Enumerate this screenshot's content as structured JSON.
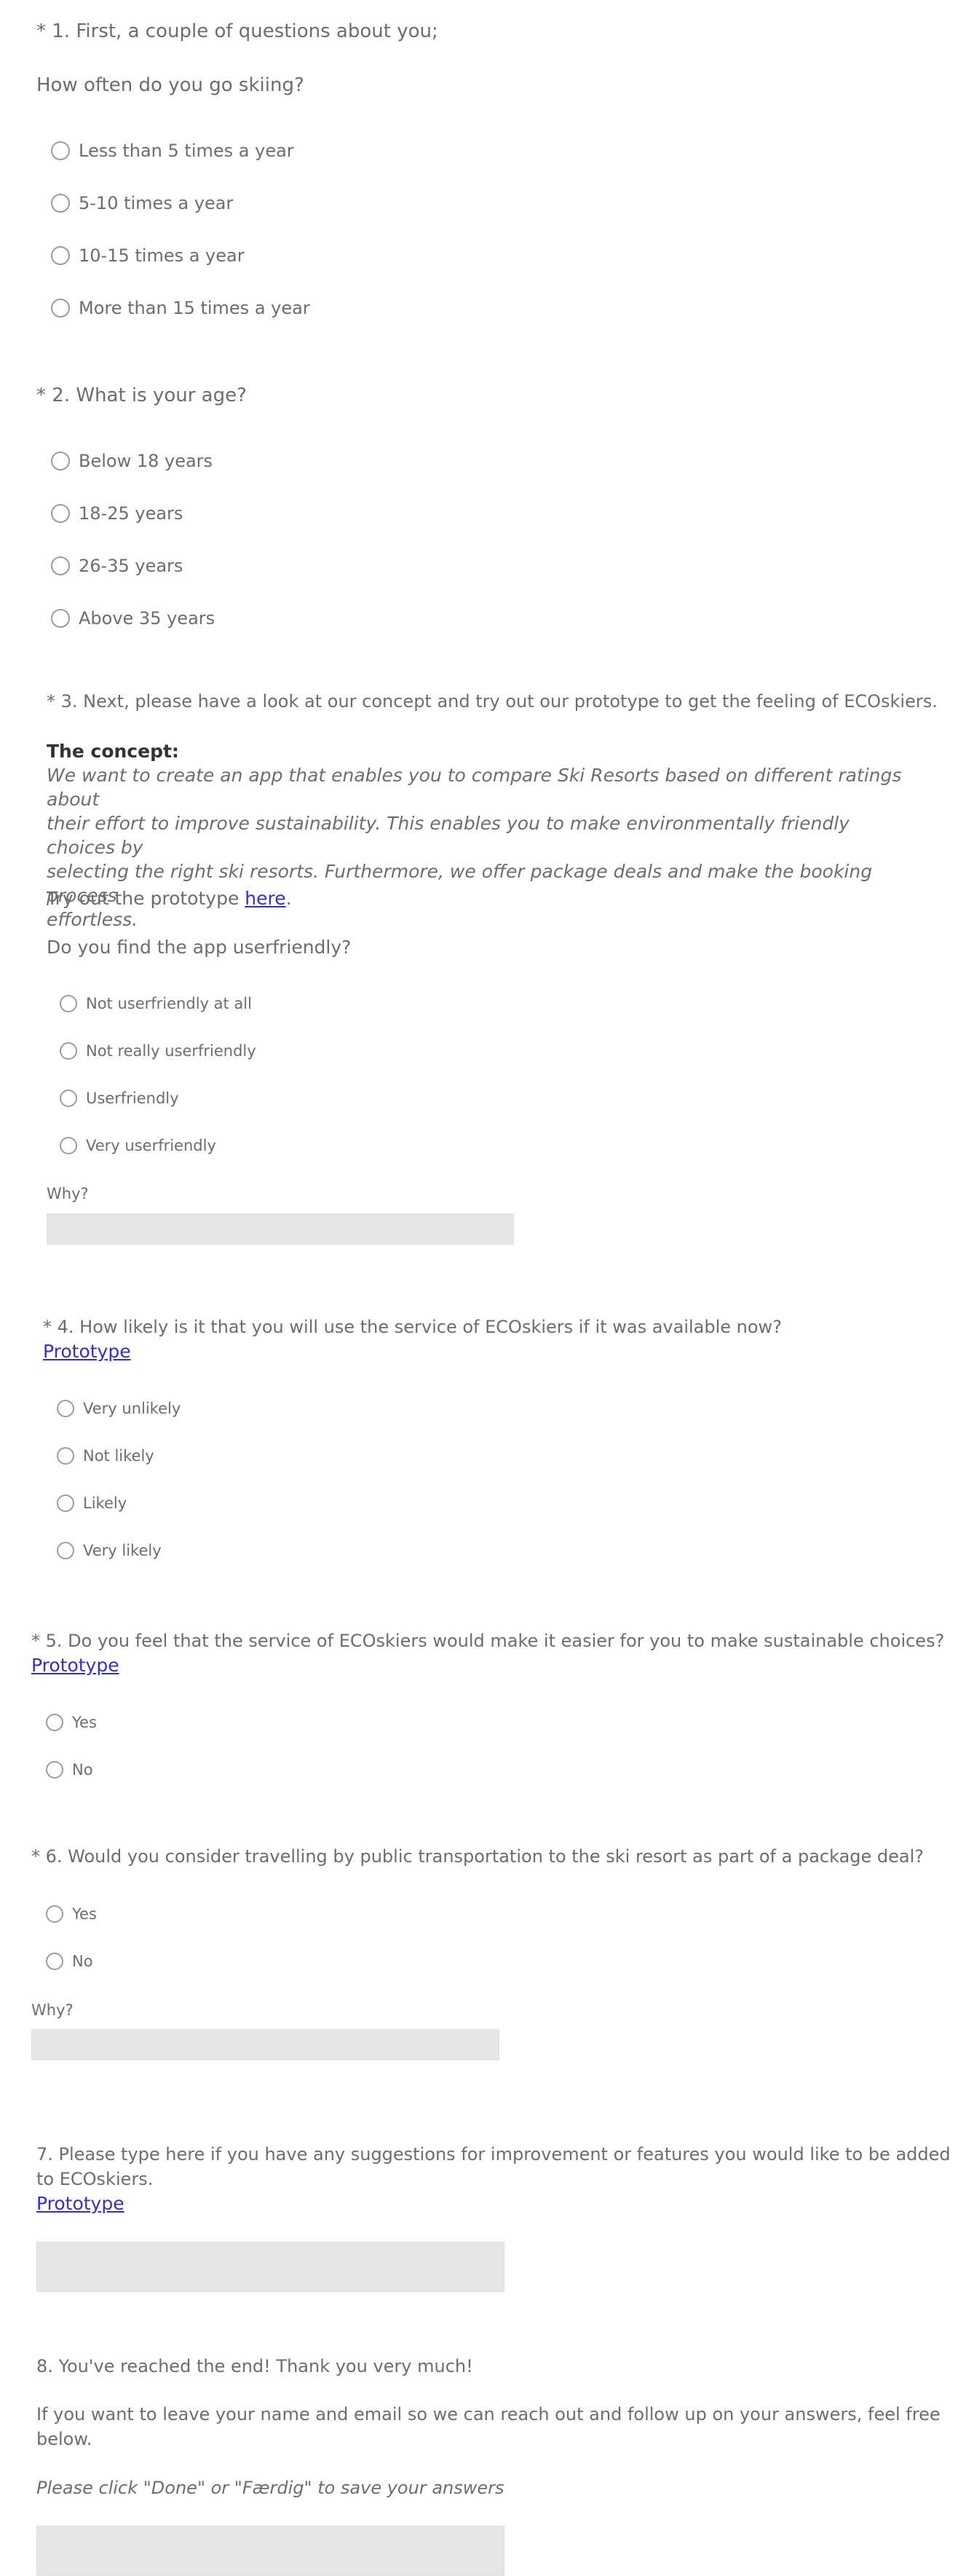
{
  "q1": {
    "title": "* 1. First, a couple of questions about you;",
    "subtitle": "How often do you go skiing?",
    "options": [
      "Less than 5 times a year",
      "5-10 times a year",
      "10-15 times a year",
      "More than 15 times a year"
    ]
  },
  "q2": {
    "title": "* 2. What is your age?",
    "options": [
      "Below 18 years",
      "18-25 years",
      "26-35 years",
      "Above 35 years"
    ]
  },
  "q3": {
    "title": "* 3. Next, please have a look at our concept and try out our prototype to get the feeling of ECOskiers.",
    "concept_heading": "The concept:",
    "concept_text": "We want to create an app that enables you to compare Ski Resorts based on different ratings about\ntheir effort to improve sustainability. This enables you to make environmentally friendly choices by\nselecting the right ski resorts. Furthermore, we offer package deals and make the booking process\neffortless.",
    "try_prefix": "Try out the prototype ",
    "try_link": "here",
    "try_suffix": ".",
    "question": "Do you find the app userfriendly?",
    "options": [
      "Not userfriendly at all",
      "Not really userfriendly",
      "Userfriendly",
      "Very userfriendly"
    ],
    "why_label": "Why?",
    "why_value": ""
  },
  "q4": {
    "title": "* 4. How likely is it that you will use the service of ECOskiers if it was available now?",
    "link": "Prototype",
    "options": [
      "Very unlikely",
      "Not likely",
      "Likely",
      "Very likely"
    ]
  },
  "q5": {
    "title": "* 5. Do you feel that the service of ECOskiers would make it easier for you to make sustainable choices?",
    "link": "Prototype",
    "options": [
      "Yes",
      "No"
    ]
  },
  "q6": {
    "title": "* 6. Would you consider travelling by public transportation to the ski resort as part of a package deal?",
    "options": [
      "Yes",
      "No"
    ],
    "why_label": "Why?",
    "why_value": ""
  },
  "q7": {
    "title_line1": "7. Please type here if you have any suggestions for improvement or features you would like to be added",
    "title_line2": "to ECOskiers.",
    "link": "Prototype",
    "value": ""
  },
  "q8": {
    "title": "8. You've reached the end! Thank you very much!",
    "text_line1": "If you want to leave your name and email so we can reach out and follow up on your answers, feel free",
    "text_line2": "below.",
    "note": "Please click \"Done\" or \"Færdig\" to save your answers",
    "value": ""
  }
}
